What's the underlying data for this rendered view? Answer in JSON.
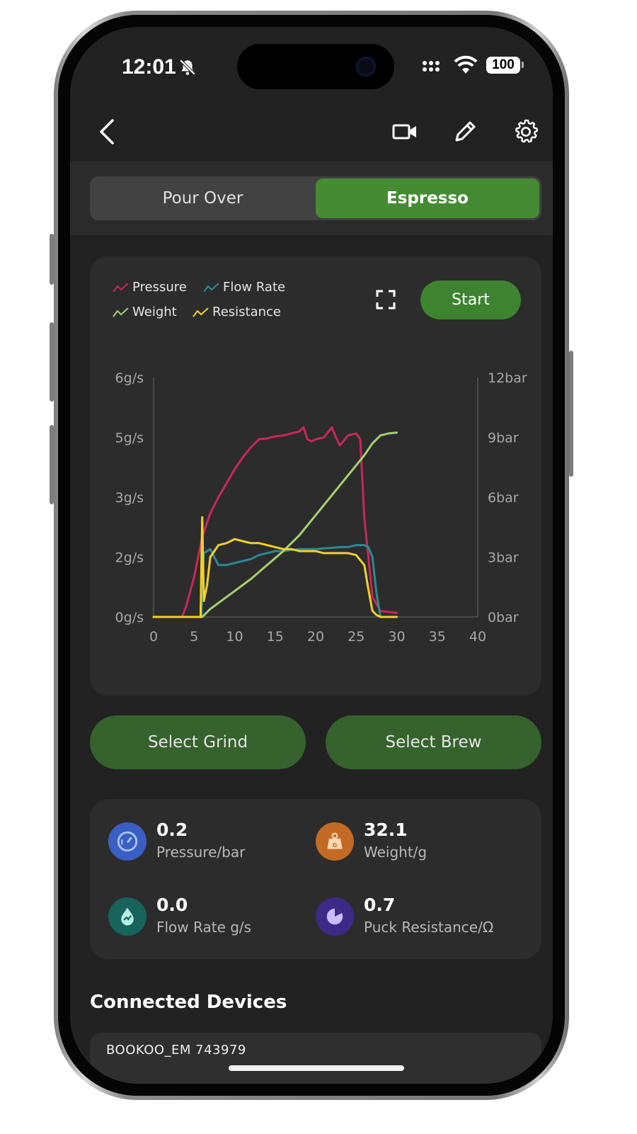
{
  "status_bar": {
    "time": "12:01",
    "battery": "100"
  },
  "top_bar": {
    "icons": [
      "back-arrow-icon",
      "video-camera-icon",
      "pencil-icon",
      "gear-icon"
    ]
  },
  "mode_toggle": {
    "options": [
      "Pour Over",
      "Espresso"
    ],
    "selected": "Espresso"
  },
  "chart_card": {
    "legend": [
      "Pressure",
      "Flow Rate",
      "Weight",
      "Resistance"
    ],
    "start_label": "Start"
  },
  "colors": {
    "pressure": "#c9285a",
    "flow_rate": "#2b8a92",
    "weight": "#a3d16e",
    "resistance": "#f2d129",
    "accent": "#3e8330"
  },
  "chart_data": {
    "type": "line",
    "x_ticks": [
      "0",
      "5",
      "10",
      "15",
      "20",
      "25",
      "30",
      "35",
      "40"
    ],
    "xlim": [
      0,
      40
    ],
    "y_left_ticks": [
      "0g/s",
      "2g/s",
      "3g/s",
      "5g/s",
      "6g/s"
    ],
    "y_left_range": [
      0,
      6
    ],
    "y_right_ticks": [
      "0bar",
      "3bar",
      "6bar",
      "9bar",
      "12bar"
    ],
    "y_right_range": [
      0,
      12
    ],
    "grid": false,
    "legend_position": "top-left",
    "series": [
      {
        "name": "Pressure",
        "axis": "right",
        "x": [
          0,
          3.5,
          4,
          5,
          6,
          7,
          8,
          9,
          10,
          11,
          12,
          13,
          14,
          15,
          16,
          17,
          18,
          18.5,
          19,
          19.5,
          20,
          21,
          22,
          22.5,
          23,
          24,
          25,
          25.5,
          26,
          27,
          28,
          29,
          30
        ],
        "y": [
          0,
          0,
          0.5,
          2.0,
          4.0,
          5.2,
          6.0,
          6.7,
          7.4,
          8.0,
          8.5,
          8.9,
          8.95,
          9.05,
          9.1,
          9.2,
          9.3,
          9.5,
          8.9,
          8.8,
          8.9,
          9.0,
          9.5,
          9.0,
          8.6,
          9.1,
          9.2,
          8.9,
          5.0,
          1.0,
          0.3,
          0.25,
          0.2
        ]
      },
      {
        "name": "Flow Rate",
        "axis": "left",
        "x": [
          0,
          5.9,
          6,
          6.2,
          7,
          8,
          9,
          10,
          11,
          12,
          13,
          14,
          15,
          16,
          17,
          18,
          19,
          20,
          21,
          22,
          23,
          24,
          25,
          26,
          26.5,
          27,
          27.5,
          28
        ],
        "y": [
          0,
          0,
          0.8,
          1.6,
          1.7,
          1.3,
          1.3,
          1.35,
          1.4,
          1.45,
          1.55,
          1.6,
          1.65,
          1.65,
          1.68,
          1.7,
          1.7,
          1.7,
          1.72,
          1.73,
          1.75,
          1.75,
          1.8,
          1.8,
          1.75,
          1.5,
          0.6,
          0.0
        ]
      },
      {
        "name": "Weight",
        "axis": "left",
        "x": [
          0,
          6,
          6.5,
          7,
          8,
          10,
          12,
          14,
          16,
          18,
          20,
          22,
          24,
          26,
          27,
          28,
          29,
          30
        ],
        "y": [
          0,
          0,
          0.1,
          0.2,
          0.35,
          0.65,
          0.95,
          1.3,
          1.65,
          2.05,
          2.55,
          3.05,
          3.55,
          4.05,
          4.35,
          4.55,
          4.6,
          4.62
        ]
      },
      {
        "name": "Resistance",
        "axis": "left",
        "x": [
          0,
          5.8,
          6,
          6.2,
          6.6,
          7,
          8,
          9,
          10,
          11,
          12,
          13,
          14,
          15,
          16,
          17,
          18,
          19,
          20,
          21,
          22,
          23,
          24,
          25,
          26,
          26.5,
          27,
          27.5,
          28,
          30
        ],
        "y": [
          0,
          0,
          2.5,
          0.4,
          0.8,
          1.5,
          1.8,
          1.85,
          1.95,
          1.9,
          1.85,
          1.85,
          1.8,
          1.75,
          1.7,
          1.7,
          1.65,
          1.65,
          1.65,
          1.6,
          1.6,
          1.6,
          1.6,
          1.55,
          1.3,
          0.7,
          0.15,
          0.05,
          0.0,
          0.0
        ]
      }
    ]
  },
  "actions": {
    "grind_label": "Select Grind",
    "brew_label": "Select Brew"
  },
  "stats": [
    {
      "value": "0.2",
      "label": "Pressure/bar",
      "icon": "gauge-icon",
      "color": "#3a5fc4"
    },
    {
      "value": "32.1",
      "label": "Weight/g",
      "icon": "weight-icon",
      "color": "#c36a24"
    },
    {
      "value": "0.0",
      "label": "Flow Rate g/s",
      "icon": "water-drop-icon",
      "color": "#16645c"
    },
    {
      "value": "0.7",
      "label": "Puck Resistance/Ω",
      "icon": "pie-chart-icon",
      "color": "#3b2a86"
    }
  ],
  "connected": {
    "title": "Connected Devices",
    "devices": [
      {
        "name": "BOOKOO_EM 743979"
      }
    ]
  }
}
